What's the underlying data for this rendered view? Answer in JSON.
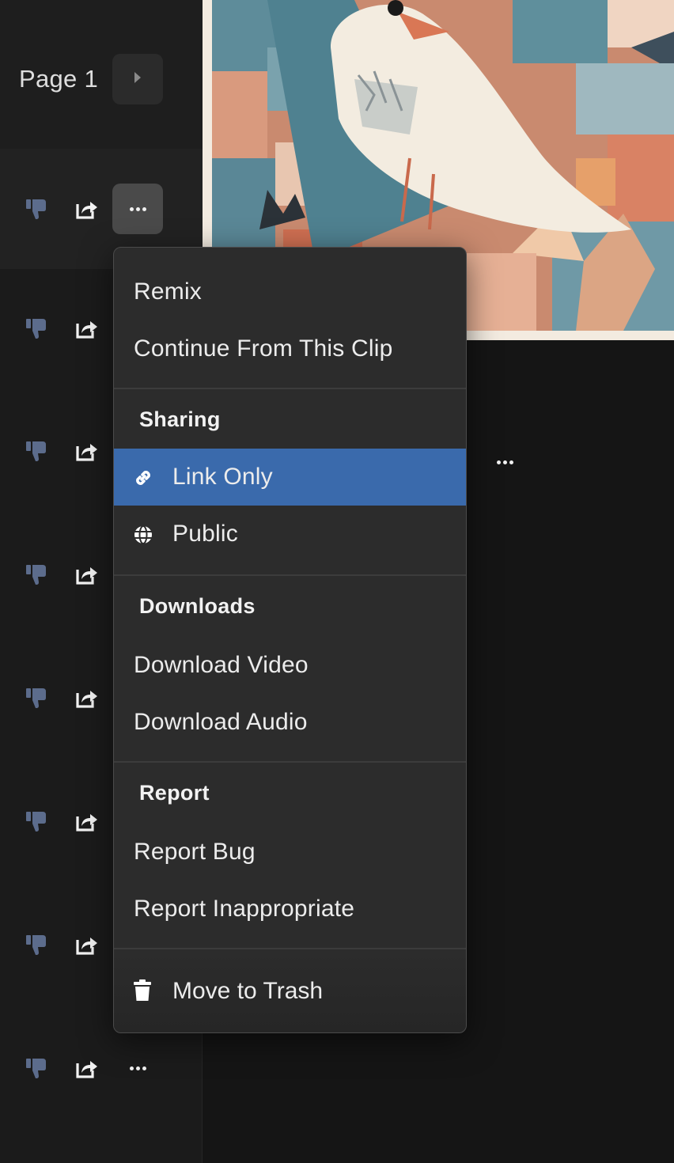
{
  "pager": {
    "label": "Page 1"
  },
  "clip_rows": {
    "count": 8
  },
  "menu": {
    "remix": "Remix",
    "continue": "Continue From This Clip",
    "sharing_header": "Sharing",
    "link_only": "Link Only",
    "public": "Public",
    "downloads_header": "Downloads",
    "download_video": "Download Video",
    "download_audio": "Download Audio",
    "report_header": "Report",
    "report_bug": "Report Bug",
    "report_inappropriate": "Report Inappropriate",
    "trash": "Move to Trash",
    "selected_sharing": "Link Only"
  },
  "colors": {
    "background": "#151515",
    "menu_bg": "#2c2c2c",
    "selected": "#3a6aac",
    "thumb_icon": "#5c6c8c"
  },
  "icons": {
    "pager_next": "caret-right-icon",
    "thumb": "thumbs-down-icon",
    "share": "share-icon",
    "more": "more-dots-icon",
    "link": "link-icon",
    "globe": "globe-icon",
    "trash": "trash-icon"
  }
}
